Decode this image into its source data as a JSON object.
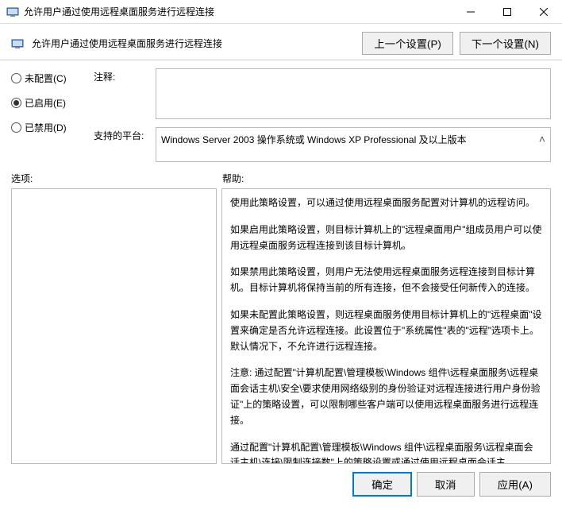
{
  "titlebar": {
    "title": "允许用户通过使用远程桌面服务进行远程连接"
  },
  "header": {
    "title": "允许用户通过使用远程桌面服务进行远程连接",
    "prev": "上一个设置(P)",
    "next": "下一个设置(N)"
  },
  "radios": {
    "not_configured": "未配置(C)",
    "enabled": "已启用(E)",
    "disabled": "已禁用(D)",
    "selected": "enabled"
  },
  "fields": {
    "comment_label": "注释:",
    "comment_value": "",
    "platform_label": "支持的平台:",
    "platform_value": "Windows Server 2003 操作系统或 Windows XP Professional 及以上版本"
  },
  "section_labels": {
    "options": "选项:",
    "help": "帮助:"
  },
  "help_paragraphs": [
    "使用此策略设置，可以通过使用远程桌面服务配置对计算机的远程访问。",
    "如果启用此策略设置，则目标计算机上的\"远程桌面用户\"组成员用户可以使用远程桌面服务远程连接到该目标计算机。",
    "如果禁用此策略设置，则用户无法使用远程桌面服务远程连接到目标计算机。目标计算机将保持当前的所有连接，但不会接受任何新传入的连接。",
    "如果未配置此策略设置，则远程桌面服务使用目标计算机上的\"远程桌面\"设置来确定是否允许远程连接。此设置位于\"系统属性\"表的\"远程\"选项卡上。默认情况下，不允许进行远程连接。",
    "注意: 通过配置\"计算机配置\\管理模板\\Windows 组件\\远程桌面服务\\远程桌面会话主机\\安全\\要求使用网络级别的身份验证对远程连接进行用户身份验证\"上的策略设置，可以限制哪些客户端可以使用远程桌面服务进行远程连接。",
    "通过配置\"计算机配置\\管理模板\\Windows 组件\\远程桌面服务\\远程桌面会话主机\\连接\\限制连接数\"上的策略设置或通过使用远程桌面会话主"
  ],
  "footer": {
    "ok": "确定",
    "cancel": "取消",
    "apply": "应用(A)"
  }
}
